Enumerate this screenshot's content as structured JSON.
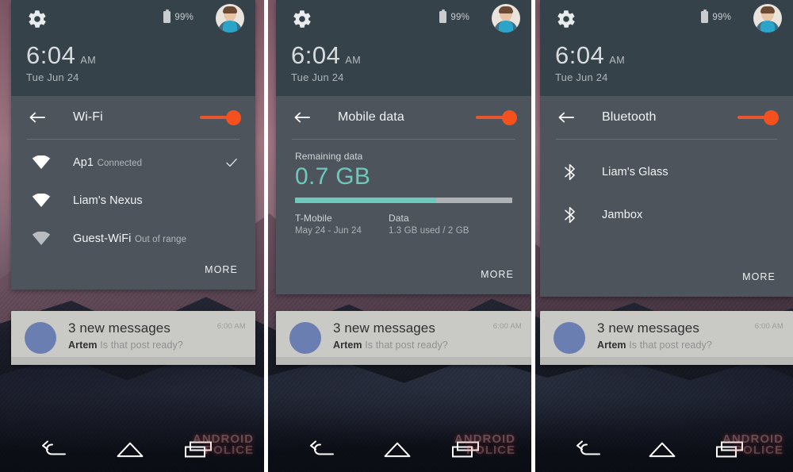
{
  "meta": {
    "watermark_line1": "ANDROID",
    "watermark_line2": "POLICE",
    "accent_orange": "#f4511e",
    "accent_teal": "#6ec9bd",
    "panel_bg": "#4d545b",
    "panel_header_bg": "#35424a"
  },
  "status": {
    "battery_percent": "99%",
    "gear_icon": "gear-icon",
    "battery_icon": "battery-icon",
    "avatar_icon": "user-avatar"
  },
  "clock": {
    "time": "6:04",
    "ampm": "AM",
    "date": "Tue Jun 24"
  },
  "notification": {
    "title": "3 new messages",
    "sender": "Artem",
    "message": "Is that post ready?",
    "time": "6:00 AM"
  },
  "navbar": {
    "back_label": "back-icon",
    "home_label": "home-icon",
    "recents_label": "recents-icon"
  },
  "more_label": "MORE",
  "panels": [
    {
      "id": "wifi",
      "title": "Wi-Fi",
      "toggle_on": true,
      "items": [
        {
          "name": "Ap1",
          "sub": "Connected",
          "icon": "wifi-signal-full-icon",
          "checked": true
        },
        {
          "name": "Liam's Nexus",
          "sub": "",
          "icon": "wifi-signal-full-icon",
          "checked": false
        },
        {
          "name": "Guest-WiFi",
          "sub": "Out of range",
          "icon": "wifi-signal-dim-icon",
          "checked": false
        }
      ]
    },
    {
      "id": "mobile-data",
      "title": "Mobile data",
      "toggle_on": true,
      "data": {
        "remaining_label": "Remaining data",
        "remaining_value": "0.7 GB",
        "progress_percent": 65,
        "carrier_label": "T-Mobile",
        "carrier_period": "May 24 - Jun 24",
        "usage_label": "Data",
        "usage_value": "1.3 GB used / 2 GB"
      }
    },
    {
      "id": "bluetooth",
      "title": "Bluetooth",
      "toggle_on": true,
      "items": [
        {
          "name": "Liam's Glass",
          "sub": "",
          "icon": "bluetooth-icon",
          "checked": false
        },
        {
          "name": "Jambox",
          "sub": "",
          "icon": "bluetooth-icon",
          "checked": false
        }
      ]
    }
  ]
}
